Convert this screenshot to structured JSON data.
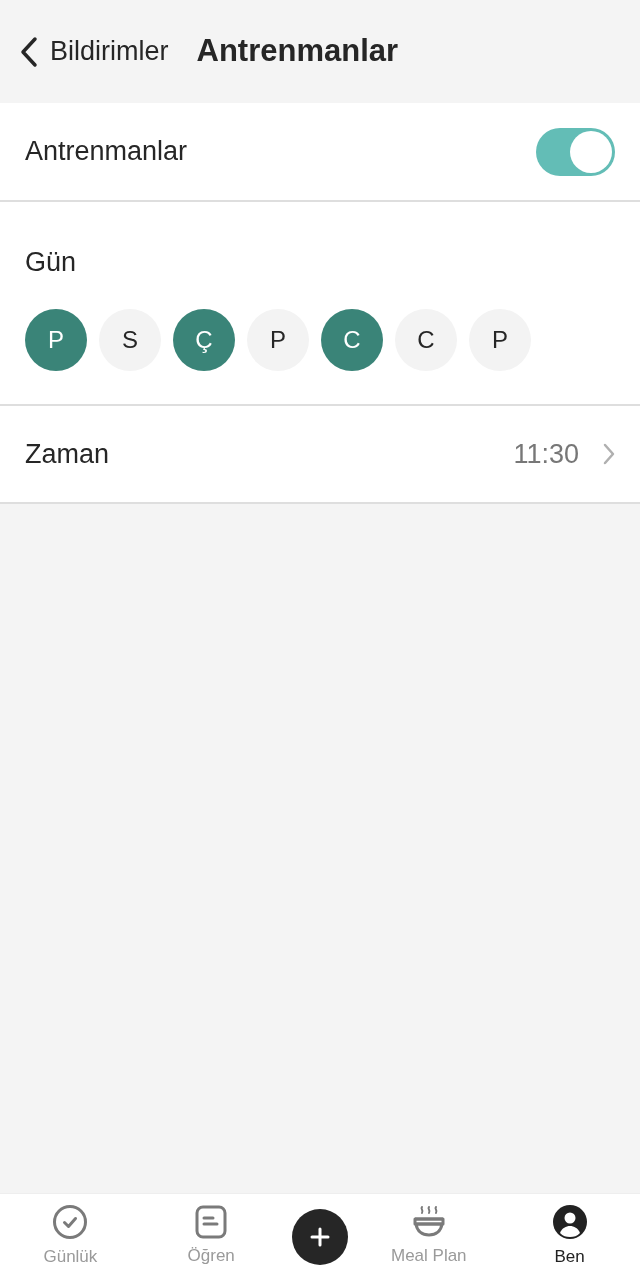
{
  "header": {
    "back_label": "Bildirimler",
    "title": "Antrenmanlar"
  },
  "toggle_row": {
    "label": "Antrenmanlar",
    "on": true
  },
  "days_section": {
    "label": "Gün",
    "days": [
      {
        "label": "P",
        "selected": true
      },
      {
        "label": "S",
        "selected": false
      },
      {
        "label": "Ç",
        "selected": true
      },
      {
        "label": "P",
        "selected": false
      },
      {
        "label": "C",
        "selected": true
      },
      {
        "label": "C",
        "selected": false
      },
      {
        "label": "P",
        "selected": false
      }
    ]
  },
  "time_row": {
    "label": "Zaman",
    "value": "11:30"
  },
  "tab_bar": [
    {
      "kind": "log",
      "label": "Günlük",
      "selected": false
    },
    {
      "kind": "learn",
      "label": "Öğren",
      "selected": false
    },
    {
      "kind": "add"
    },
    {
      "kind": "meal",
      "label": "Meal Plan",
      "selected": false
    },
    {
      "kind": "profile",
      "label": "Ben",
      "selected": true
    }
  ]
}
